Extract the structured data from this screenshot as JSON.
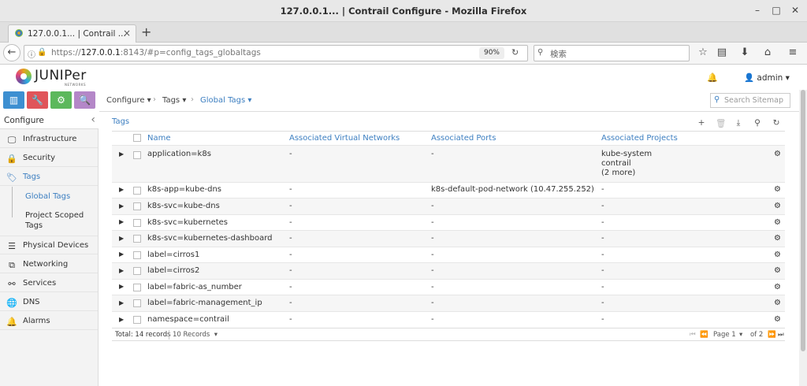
{
  "window": {
    "title": "127.0.0.1... | Contrail Configure - Mozilla Firefox"
  },
  "browser": {
    "tab_label": "127.0.0.1... | Contrail ...",
    "url_prefix": "https://",
    "url_host": "127.0.0.1",
    "url_rest": ":8143/#p=config_tags_globaltags",
    "zoom": "90%",
    "search_placeholder": "検索"
  },
  "header": {
    "logo_text": "JUNIPer",
    "logo_sub": "NETWORKS",
    "user": "admin"
  },
  "sidebar": {
    "title": "Configure",
    "items": [
      {
        "label": "Infrastructure",
        "icon": "monitor-icon"
      },
      {
        "label": "Security",
        "icon": "lock-icon"
      },
      {
        "label": "Tags",
        "icon": "tag-icon"
      },
      {
        "label": "Physical Devices",
        "icon": "server-icon"
      },
      {
        "label": "Networking",
        "icon": "network-icon"
      },
      {
        "label": "Services",
        "icon": "services-icon"
      },
      {
        "label": "DNS",
        "icon": "globe-icon"
      },
      {
        "label": "Alarms",
        "icon": "bell-icon"
      }
    ],
    "subitems": [
      {
        "label": "Global Tags"
      },
      {
        "label": "Project Scoped Tags"
      }
    ]
  },
  "breadcrumb": {
    "c1": "Configure",
    "c2": "Tags",
    "c3": "Global Tags"
  },
  "site_search_placeholder": "Search Sitemap",
  "grid": {
    "title": "Tags",
    "columns": {
      "name": "Name",
      "vn": "Associated Virtual Networks",
      "ports": "Associated Ports",
      "projects": "Associated Projects"
    },
    "rows": [
      {
        "name": "application=k8s",
        "vn": "-",
        "ports": "-",
        "projects": "kube-system",
        "projects2": "contrail",
        "projects3": "(2 more)"
      },
      {
        "name": "k8s-app=kube-dns",
        "vn": "-",
        "ports": "k8s-default-pod-network (10.47.255.252)",
        "projects": "-"
      },
      {
        "name": "k8s-svc=kube-dns",
        "vn": "-",
        "ports": "-",
        "projects": "-"
      },
      {
        "name": "k8s-svc=kubernetes",
        "vn": "-",
        "ports": "-",
        "projects": "-"
      },
      {
        "name": "k8s-svc=kubernetes-dashboard",
        "vn": "-",
        "ports": "-",
        "projects": "-"
      },
      {
        "name": "label=cirros1",
        "vn": "-",
        "ports": "-",
        "projects": "-"
      },
      {
        "name": "label=cirros2",
        "vn": "-",
        "ports": "-",
        "projects": "-"
      },
      {
        "name": "label=fabric-as_number",
        "vn": "-",
        "ports": "-",
        "projects": "-"
      },
      {
        "name": "label=fabric-management_ip",
        "vn": "-",
        "ports": "-",
        "projects": "-"
      },
      {
        "name": "namespace=contrail",
        "vn": "-",
        "ports": "-",
        "projects": "-"
      }
    ],
    "footer": {
      "total": "Total: 14 records",
      "per_page": "10 Records",
      "page": "Page 1",
      "of": "of 2"
    }
  }
}
